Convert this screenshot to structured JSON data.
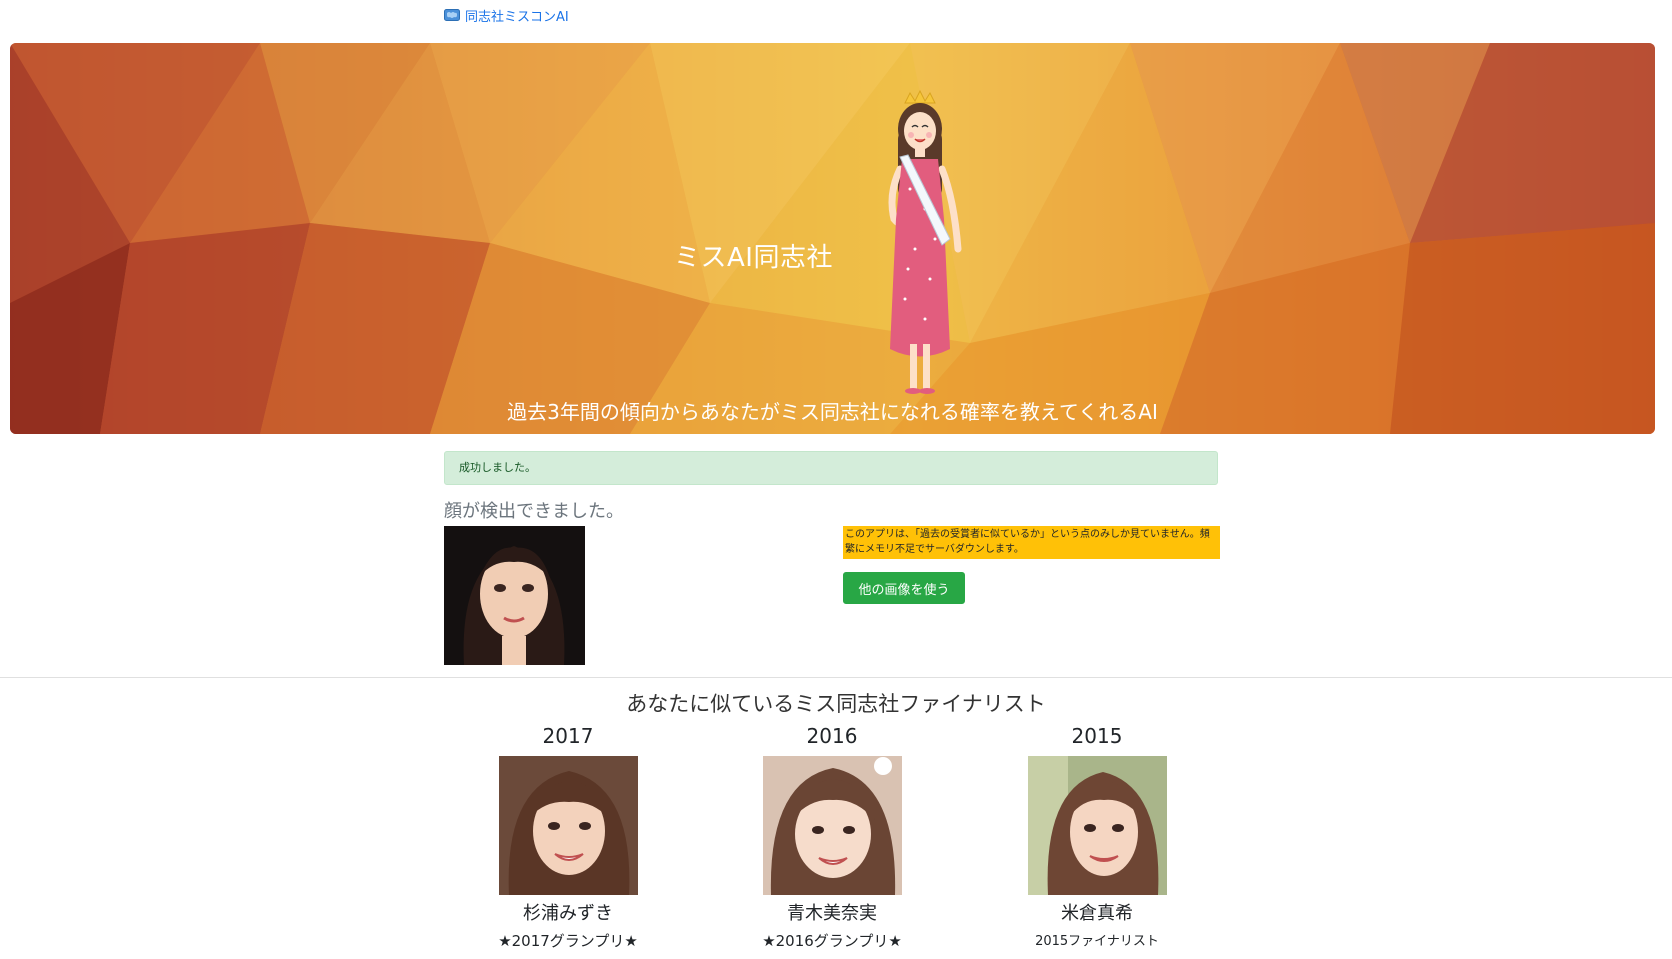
{
  "nav": {
    "brand_label": "同志社ミスコンAI",
    "brand_icon": "brain-icon"
  },
  "hero": {
    "title": "ミスAI同志社",
    "subtitle": "過去3年間の傾向からあなたがミス同志社になれる確率を教えてくれるAI",
    "mascot_icon": "miss-contest-girl-illustration"
  },
  "alert": {
    "message": "成功しました。"
  },
  "detection": {
    "heading": "顔が検出できました。",
    "warning_text": "このアプリは、「過去の受賞者に似ているか」という点のみしか見ていません。頻繁にメモリ不足でサーバダウンします。",
    "other_image_button": "他の画像を使う"
  },
  "finalists": {
    "heading": "あなたに似ているミス同志社ファイナリスト",
    "items": [
      {
        "year": "2017",
        "name": "杉浦みずき",
        "award": "★2017グランプリ★"
      },
      {
        "year": "2016",
        "name": "青木美奈実",
        "award": "★2016グランプリ★"
      },
      {
        "year": "2015",
        "name": "米倉真希",
        "award": "2015ファイナリスト"
      }
    ]
  },
  "colors": {
    "accent_green": "#28a745",
    "warning_yellow": "#ffc107",
    "success_bg": "#d4edda",
    "link_blue": "#1a73e8"
  }
}
